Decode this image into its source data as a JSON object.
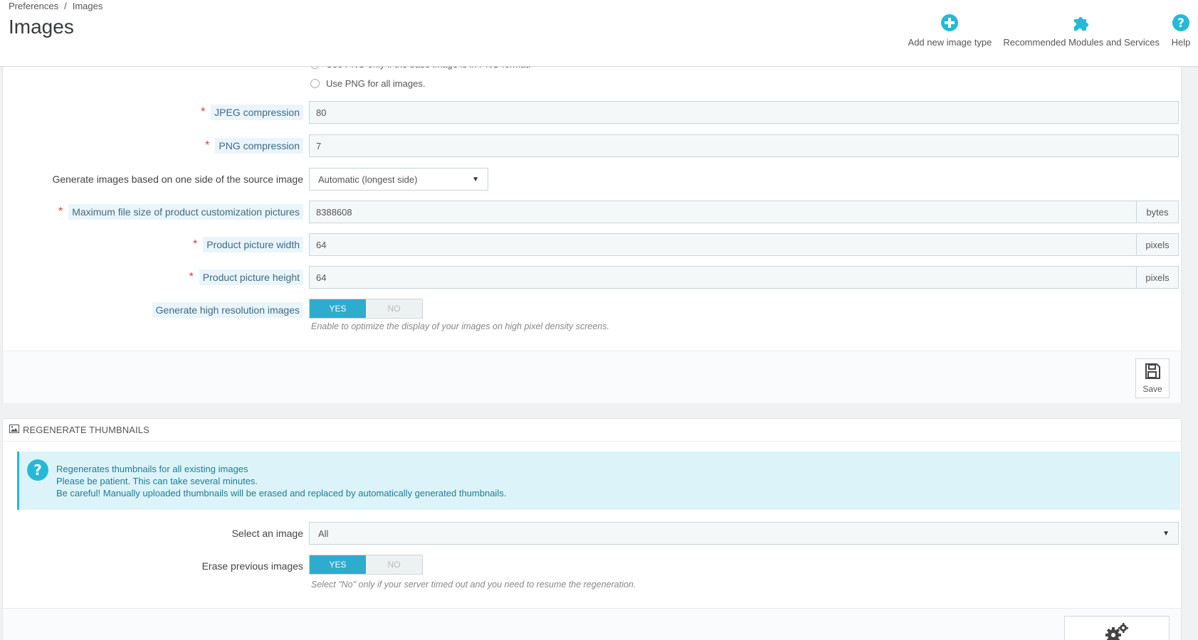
{
  "breadcrumb": {
    "parent": "Preferences",
    "separator": "/",
    "current": "Images"
  },
  "page_title": "Images",
  "toolbar": {
    "add_new": "Add new image type",
    "modules": "Recommended Modules and Services",
    "help": "Help"
  },
  "colors": {
    "accent": "#25b9d7",
    "toggle_on": "#2eacce",
    "required": "#e3343b"
  },
  "icons": {
    "add": "plus-circle-icon",
    "modules": "puzzle-icon",
    "help": "question-circle-icon",
    "save": "floppy-icon",
    "regenerate": "image-icon",
    "alert": "question-circle-icon",
    "run": "gears-icon"
  },
  "image_settings": {
    "png_option_partial": "Use PNG only if the base image is in PNG format.",
    "png_option_all": "Use PNG for all images.",
    "jpeg_label": "JPEG compression",
    "jpeg_value": "80",
    "png_label": "PNG compression",
    "png_value": "7",
    "generate_label": "Generate images based on one side of the source image",
    "generate_value": "Automatic (longest side)",
    "maxsize_label": "Maximum file size of product customization pictures",
    "maxsize_value": "8388608",
    "maxsize_unit": "bytes",
    "width_label": "Product picture width",
    "width_value": "64",
    "width_unit": "pixels",
    "height_label": "Product picture height",
    "height_value": "64",
    "height_unit": "pixels",
    "hires_label": "Generate high resolution images",
    "hires_help": "Enable to optimize the display of your images on high pixel density screens.",
    "yes": "YES",
    "no": "NO",
    "save": "Save"
  },
  "regenerate": {
    "heading": "REGENERATE THUMBNAILS",
    "alert_line1": "Regenerates thumbnails for all existing images",
    "alert_line2": "Please be patient. This can take several minutes.",
    "alert_line3": "Be careful! Manually uploaded thumbnails will be erased and replaced by automatically generated thumbnails.",
    "select_label": "Select an image",
    "select_value": "All",
    "erase_label": "Erase previous images",
    "erase_help": "Select \"No\" only if your server timed out and you need to resume the regeneration.",
    "yes": "YES",
    "no": "NO"
  }
}
